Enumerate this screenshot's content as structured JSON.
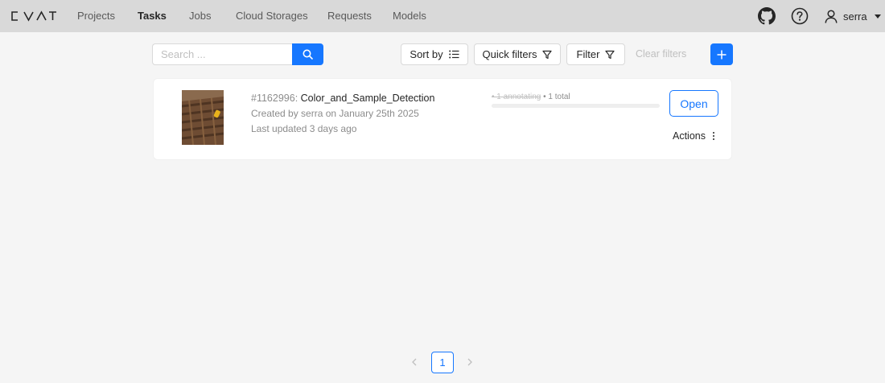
{
  "app": {
    "logo": "CVAT"
  },
  "nav": {
    "items": [
      {
        "label": "Projects"
      },
      {
        "label": "Tasks"
      },
      {
        "label": "Jobs"
      },
      {
        "label": "Cloud Storages"
      },
      {
        "label": "Requests"
      },
      {
        "label": "Models"
      }
    ],
    "active": "Tasks"
  },
  "header": {
    "username": "serra",
    "icons": [
      "github-icon",
      "help-icon",
      "user-icon"
    ]
  },
  "toolbar": {
    "search_placeholder": "Search ...",
    "sort_label": "Sort by",
    "quick_filters_label": "Quick filters",
    "filter_label": "Filter",
    "clear_filters_label": "Clear filters"
  },
  "task": {
    "id": "#1162996:",
    "name": "Color_and_Sample_Detection",
    "created": "Created by serra on January 25th 2025",
    "updated": "Last updated 3 days ago",
    "progress_annotating": "• 1 annotating",
    "progress_total": "• 1 total",
    "progress_fraction": 0,
    "open_label": "Open",
    "actions_label": "Actions"
  },
  "pagination": {
    "current": "1"
  },
  "colors": {
    "accent": "#1677ff",
    "header_bg": "#d9d9d9",
    "page_bg": "#f5f5f5"
  }
}
